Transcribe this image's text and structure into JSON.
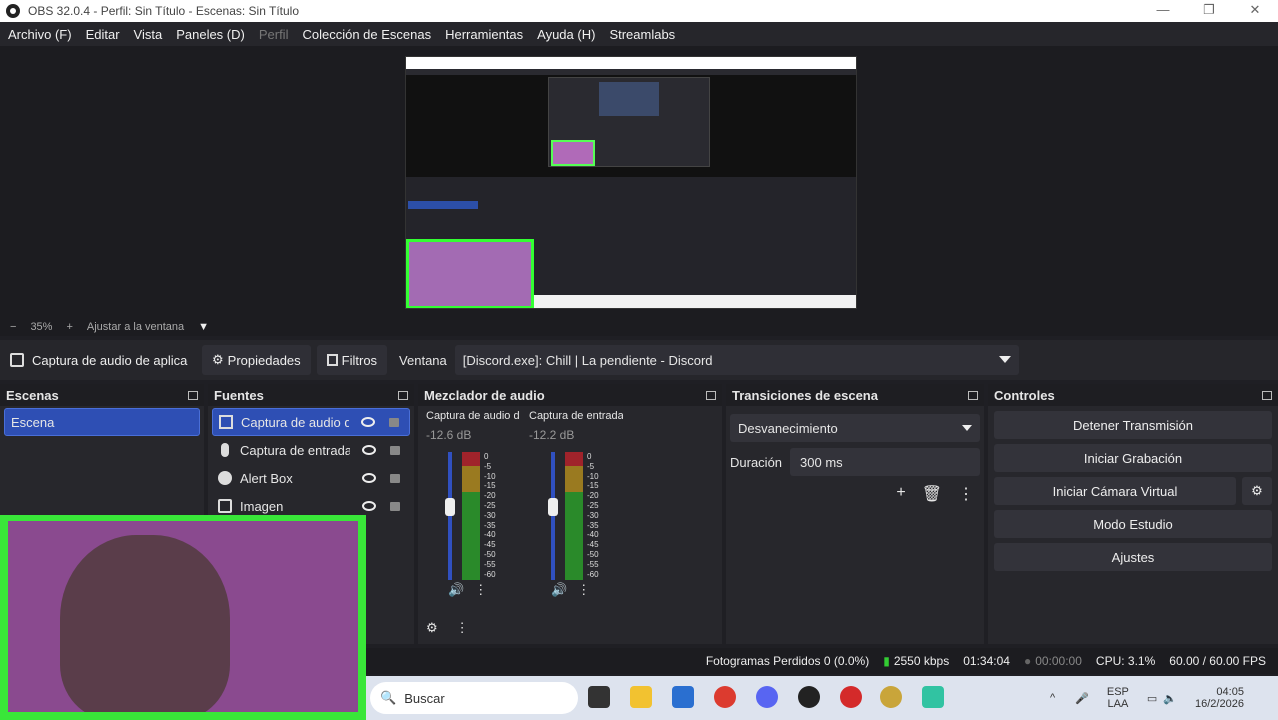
{
  "window": {
    "title": "OBS 32.0.4 - Perfil: Sin Título - Escenas: Sin Título",
    "controls": [
      "—",
      "❐",
      "✕"
    ]
  },
  "menu": [
    {
      "label": "Archivo (F)",
      "enabled": true
    },
    {
      "label": "Editar",
      "enabled": true
    },
    {
      "label": "Vista",
      "enabled": true
    },
    {
      "label": "Paneles (D)",
      "enabled": true
    },
    {
      "label": "Perfil",
      "enabled": false
    },
    {
      "label": "Colección de Escenas",
      "enabled": true
    },
    {
      "label": "Herramientas",
      "enabled": true
    },
    {
      "label": "Ayuda (H)",
      "enabled": true
    },
    {
      "label": "Streamlabs",
      "enabled": true
    }
  ],
  "zoom": {
    "minus": "−",
    "value": "35%",
    "plus": "+",
    "fit": "Ajustar a la ventana",
    "arrow": "▼"
  },
  "source_bar": {
    "name": "Captura de audio de aplicación",
    "properties": "Propiedades",
    "filters": "Filtros",
    "window_label": "Ventana",
    "window_value": "[Discord.exe]: Chill | La pendiente - Discord"
  },
  "scenes": {
    "title": "Escenas",
    "items": [
      "Escena"
    ]
  },
  "sources": {
    "title": "Fuentes",
    "items": [
      {
        "label": "Captura de audio de aplicación",
        "icon": "app-audio-icon"
      },
      {
        "label": "Captura de entrada de audio",
        "icon": "microphone-icon"
      },
      {
        "label": "Alert Box",
        "icon": "globe-icon"
      },
      {
        "label": "Imagen",
        "icon": "image-icon"
      }
    ]
  },
  "mixer": {
    "title": "Mezclador de audio",
    "channels": [
      {
        "name": "Captura de audio de aplicación",
        "db": "-12.6 dB",
        "level": 0.58
      },
      {
        "name": "Captura de entrada de audio",
        "db": "-12.2 dB",
        "level": 0.58
      }
    ],
    "scale": [
      "0",
      "-5",
      "-10",
      "-15",
      "-20",
      "-25",
      "-30",
      "-35",
      "-40",
      "-45",
      "-50",
      "-55",
      "-60"
    ]
  },
  "transitions": {
    "title": "Transiciones de escena",
    "type": "Desvanecimiento",
    "duration_label": "Duración",
    "duration_value": "300 ms"
  },
  "controls": {
    "title": "Controles",
    "buttons": [
      "Detener Transmisión",
      "Iniciar Grabación",
      "Iniciar Cámara Virtual",
      "Modo Estudio",
      "Ajustes"
    ]
  },
  "status": {
    "dropped": "Fotogramas Perdidos 0 (0.0%)",
    "bitrate": "2550 kbps",
    "stream_time": "01:34:04",
    "rec_time": "00:00:00",
    "cpu": "CPU: 3.1%",
    "fps": "60.00 / 60.00 FPS"
  },
  "taskbar": {
    "search": "Buscar",
    "lang1": "ESP",
    "lang2": "LAA",
    "time": "04:05",
    "date": "16/2/2026"
  }
}
